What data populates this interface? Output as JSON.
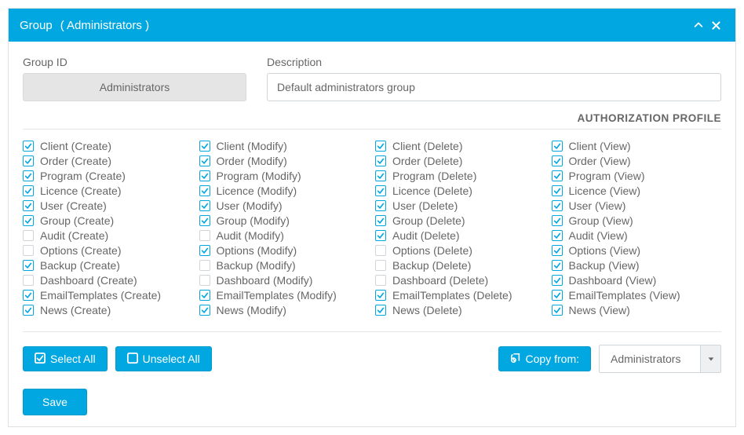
{
  "header": {
    "title_main": "Group",
    "title_sub": "( Administrators )"
  },
  "form": {
    "group_id_label": "Group ID",
    "group_id_value": "Administrators",
    "description_label": "Description",
    "description_value": "Default administrators group"
  },
  "section_title": "AUTHORIZATION PROFILE",
  "entities": [
    "Client",
    "Order",
    "Program",
    "Licence",
    "User",
    "Group",
    "Audit",
    "Options",
    "Backup",
    "Dashboard",
    "EmailTemplates",
    "News"
  ],
  "actions": [
    "Create",
    "Modify",
    "Delete",
    "View"
  ],
  "checked": {
    "Create": {
      "Client": true,
      "Order": true,
      "Program": true,
      "Licence": true,
      "User": true,
      "Group": true,
      "Audit": false,
      "Options": false,
      "Backup": true,
      "Dashboard": false,
      "EmailTemplates": true,
      "News": true
    },
    "Modify": {
      "Client": true,
      "Order": true,
      "Program": true,
      "Licence": true,
      "User": true,
      "Group": true,
      "Audit": false,
      "Options": true,
      "Backup": false,
      "Dashboard": false,
      "EmailTemplates": true,
      "News": true
    },
    "Delete": {
      "Client": true,
      "Order": true,
      "Program": true,
      "Licence": true,
      "User": true,
      "Group": true,
      "Audit": true,
      "Options": false,
      "Backup": false,
      "Dashboard": false,
      "EmailTemplates": true,
      "News": true
    },
    "View": {
      "Client": true,
      "Order": true,
      "Program": true,
      "Licence": true,
      "User": true,
      "Group": true,
      "Audit": true,
      "Options": true,
      "Backup": true,
      "Dashboard": true,
      "EmailTemplates": true,
      "News": true
    }
  },
  "buttons": {
    "select_all": "Select All",
    "unselect_all": "Unselect All",
    "copy_from": "Copy from:",
    "save": "Save"
  },
  "copy_from_select": {
    "selected": "Administrators"
  }
}
